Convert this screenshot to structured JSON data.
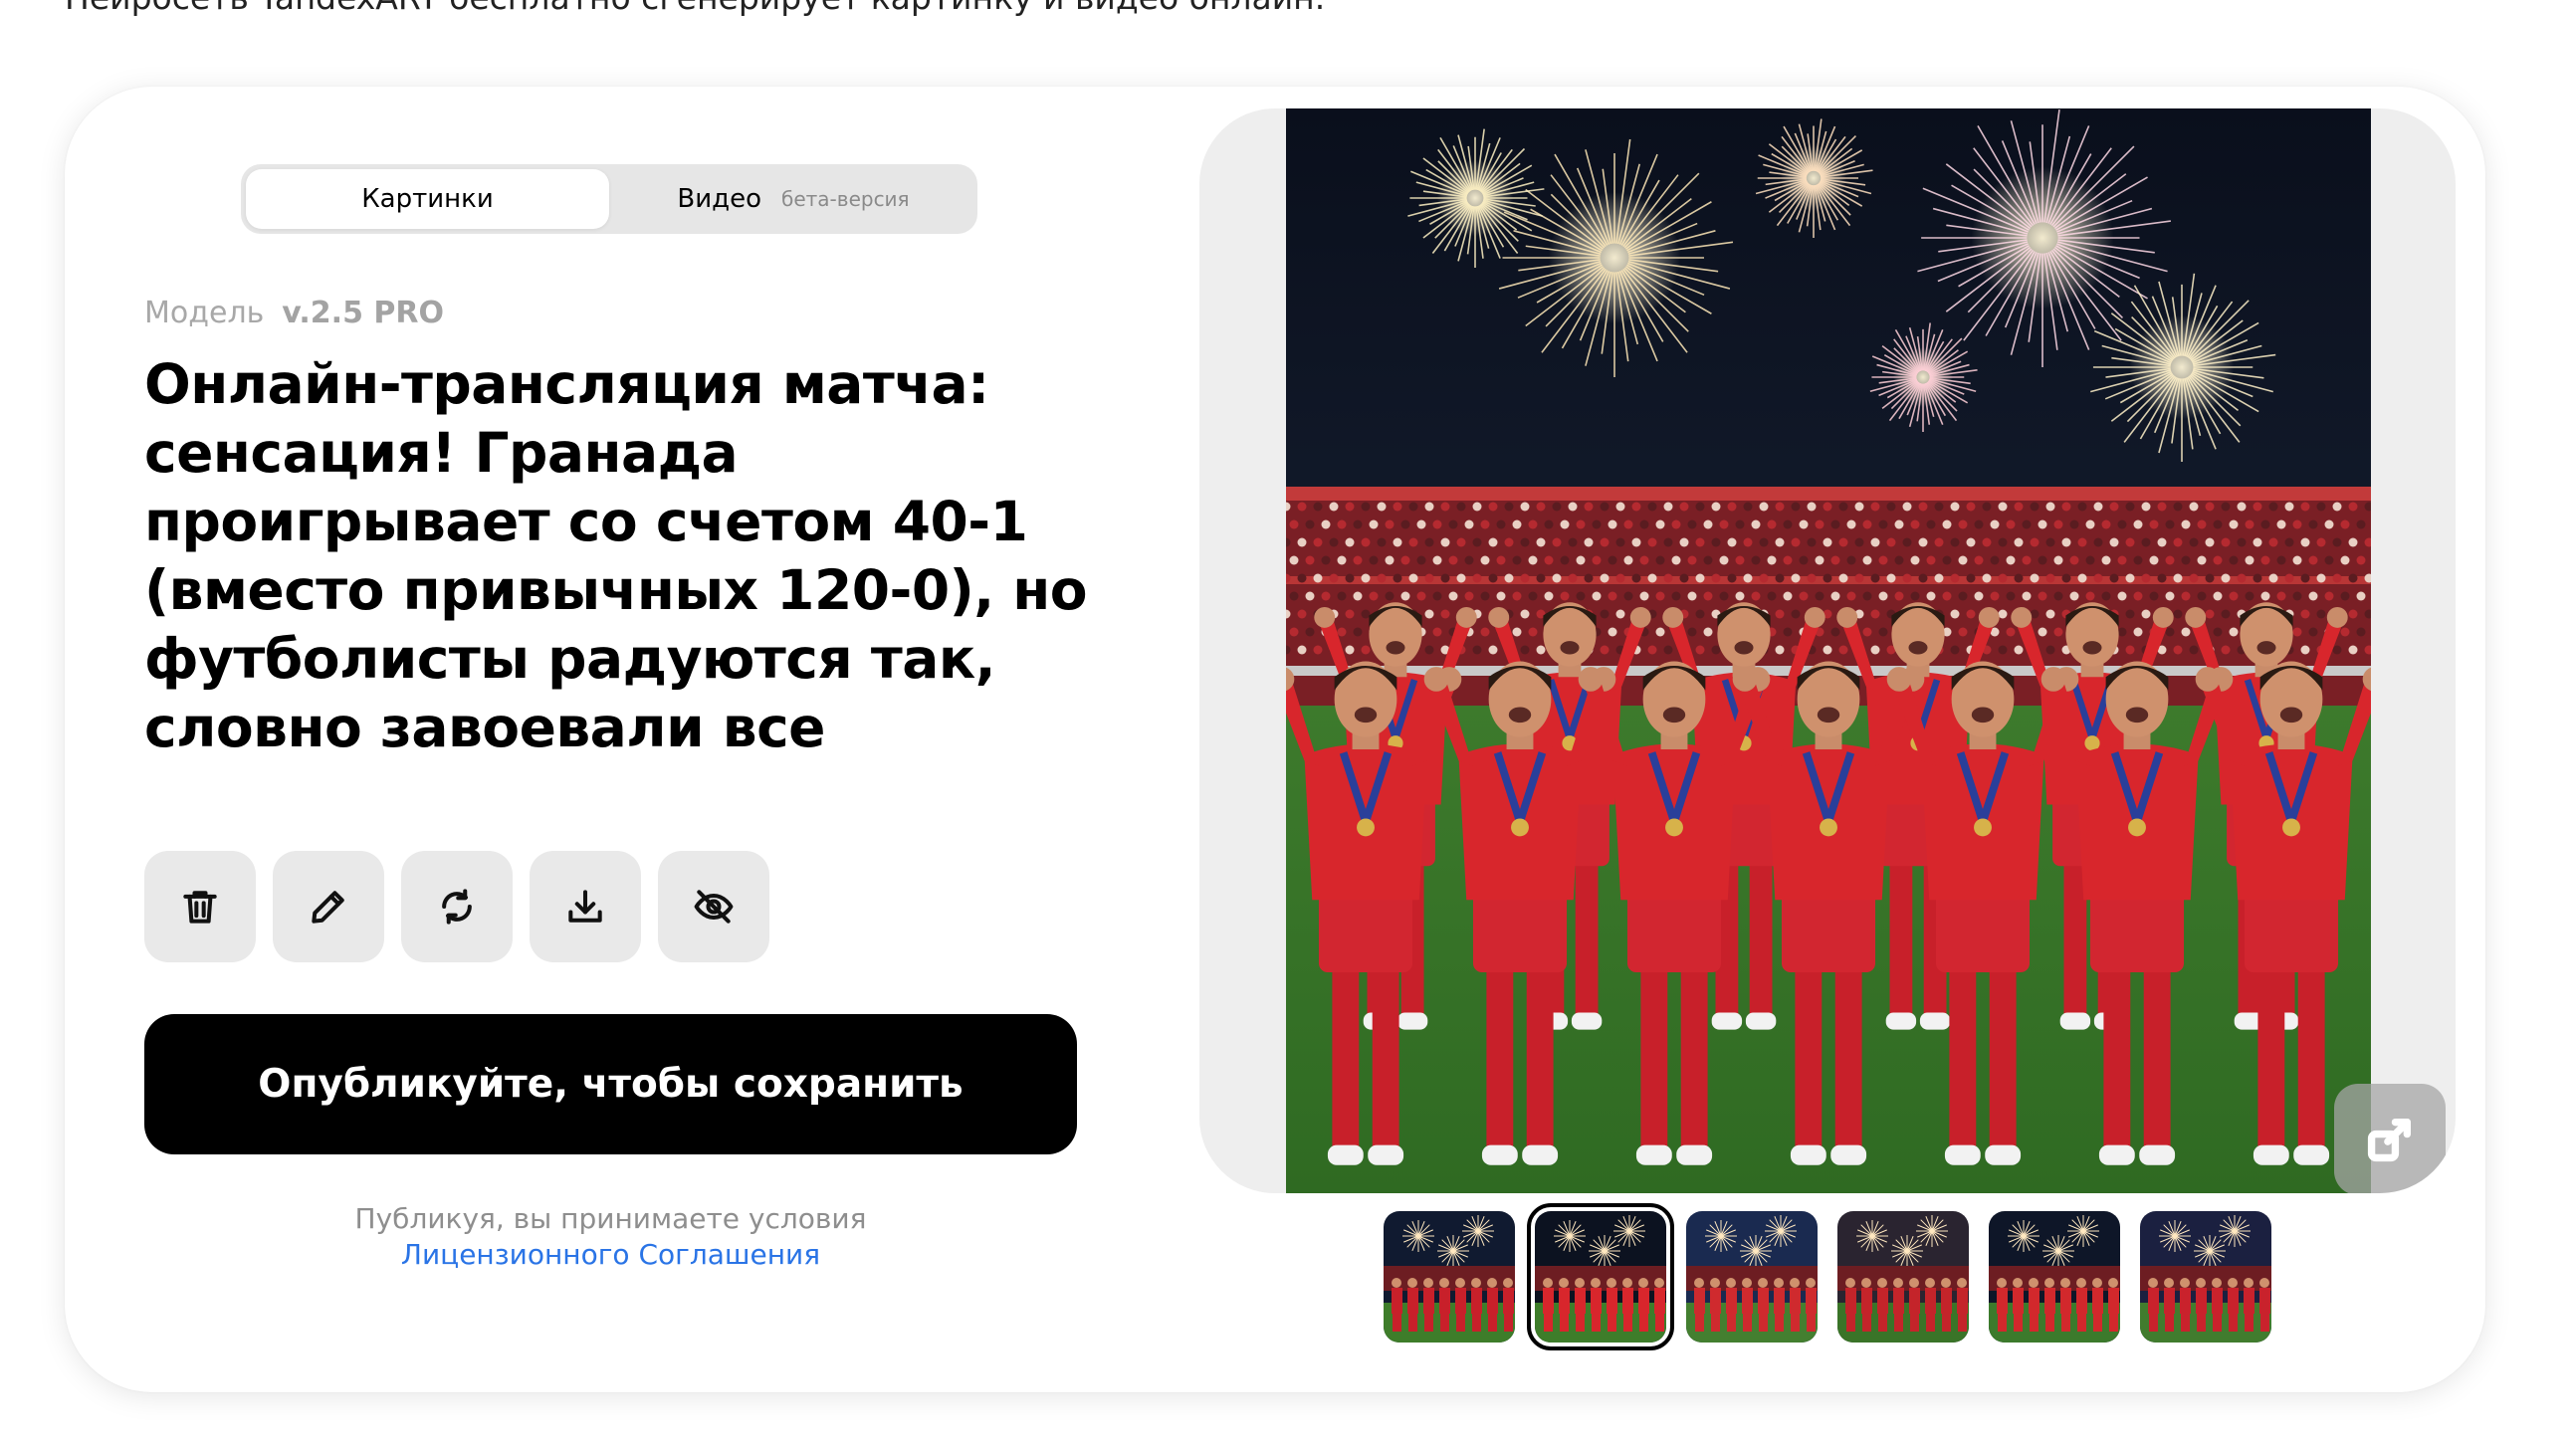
{
  "page": {
    "intro_text": "Нейросеть YandexART бесплатно сгенерирует картинку и видео онлайн."
  },
  "mode_switch": {
    "images_label": "Картинки",
    "video_label": "Видео",
    "video_badge": "бета-версия",
    "active": "Картинки"
  },
  "model": {
    "label": "Модель",
    "version": "v.2.5 PRO"
  },
  "prompt": {
    "text": "Онлайн-трансляция матча: сенсация! Гранада проигрывает со счетом 40-1 (вместо привычных 120-0), но футболисты радуются так, словно завоевали все"
  },
  "actions": [
    {
      "name": "delete",
      "icon": "trash-icon"
    },
    {
      "name": "edit",
      "icon": "pencil-icon"
    },
    {
      "name": "regenerate",
      "icon": "refresh-icon"
    },
    {
      "name": "download",
      "icon": "download-icon"
    },
    {
      "name": "hide",
      "icon": "eye-off-icon"
    }
  ],
  "publish": {
    "button_label": "Опубликуйте, чтобы сохранить",
    "terms_text": "Публикуя, вы принимаете условия",
    "terms_link": "Лицензионного Соглашения"
  },
  "preview": {
    "expand_icon": "expand-icon",
    "thumbnails_count": 6,
    "selected_thumbnail": 2
  },
  "colors": {
    "accent_link": "#2a74e6",
    "primary_button": "#000000",
    "panel_bg": "#eeeeee",
    "kit_red": "#d8262c",
    "pitch_green": "#3e7d2a",
    "night_sky": "#0c1220"
  }
}
